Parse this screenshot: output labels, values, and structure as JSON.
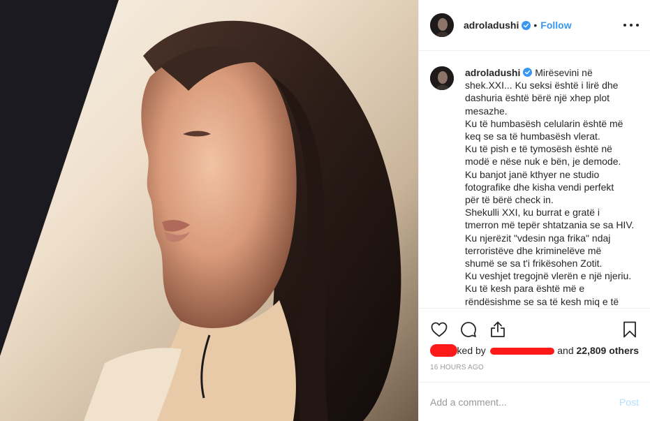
{
  "post": {
    "username": "adroladushi",
    "dot": "•",
    "follow_label": "Follow",
    "more_icon": "more-options-icon",
    "verified_color": "#3897f0"
  },
  "caption": {
    "username": "adroladushi",
    "first_line": "Mirësevini në",
    "lines": [
      "shek.XXI... Ku seksi është i lirë dhe",
      "dashuria është bërë një xhep plot",
      "mesazhe.",
      "Ku të humbasësh celularin është më",
      "keq se sa të humbasësh vlerat.",
      "Ku të pish e të tymosësh është në",
      "modë e nëse nuk e bën, je demode.",
      "Ku banjot janë kthyer ne studio",
      "fotografike dhe kisha vendi perfekt",
      "për të bërë check in.",
      "Shekulli XXI, ku burrat e gratë i",
      "tmerron më tepër shtatzania se sa HIV.",
      "Ku njerëzit \"vdesin nga frika\" ndaj",
      "terroristëve dhe kriminelëve më",
      "shumë se sa t'i frikësohen Zotit.",
      "Ku veshjet tregojnë vlerën e një njeriu.",
      "Ku të kesh para është më e",
      "rëndësishme se sa të kesh miq e të"
    ]
  },
  "actions": {
    "like_icon": "heart-icon",
    "comment_icon": "comment-icon",
    "share_icon": "share-icon",
    "save_icon": "bookmark-icon"
  },
  "likes": {
    "partial_text": "ked by",
    "and_text": "and",
    "others_count": "22,809 others"
  },
  "timestamp": "16 HOURS AGO",
  "comment": {
    "placeholder": "Add a comment...",
    "post_label": "Post"
  },
  "colors": {
    "accent": "#3897f0",
    "redaction": "#ff1a1a",
    "muted": "#999999",
    "post_disabled": "#b2dffc"
  }
}
